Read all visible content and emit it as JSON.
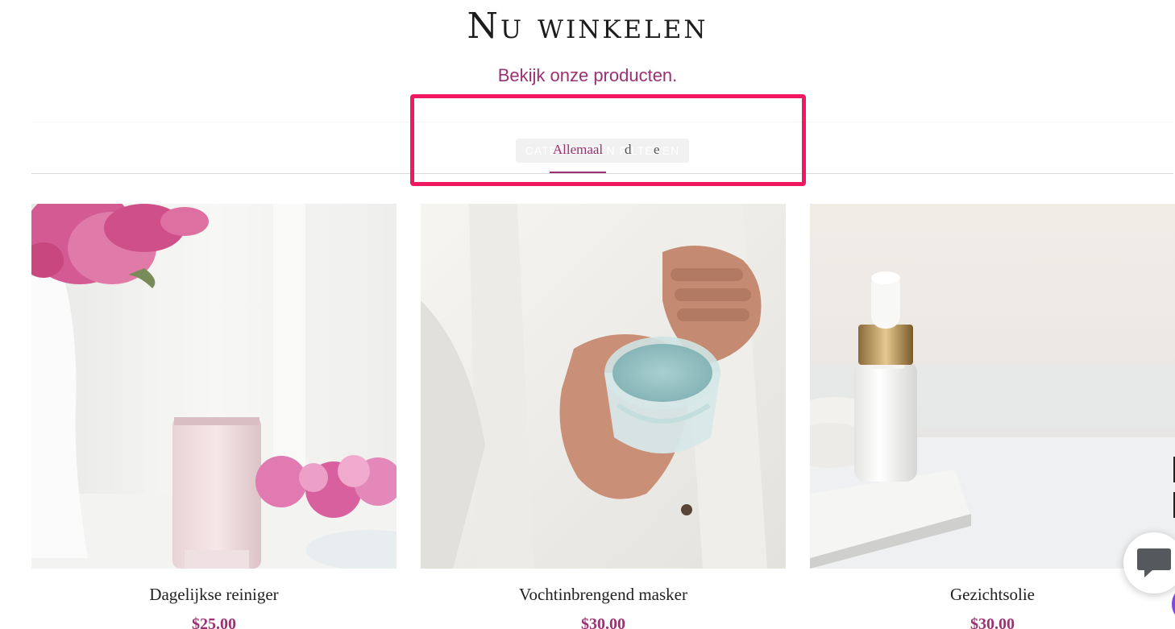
{
  "header": {
    "title": "Nu winkelen",
    "subtitle": "Bekijk onze producten."
  },
  "tabs": {
    "ghost_label": "CATEGORIEËN FILTEREN",
    "active_label": "Allemaal",
    "ghost_fragment_1": "d",
    "ghost_fragment_2": "e"
  },
  "products": [
    {
      "name": "Dagelijkse reiniger",
      "price": "$25.00"
    },
    {
      "name": "Vochtinbrengend masker",
      "price": "$30.00"
    },
    {
      "name": "Gezichtsolie",
      "price": "$30.00"
    }
  ],
  "colors": {
    "accent": "#9b3173",
    "highlight": "#f0185f",
    "chat_badge": "#7b4ad8"
  },
  "icons": {
    "chat": "chat-bubble-icon"
  }
}
